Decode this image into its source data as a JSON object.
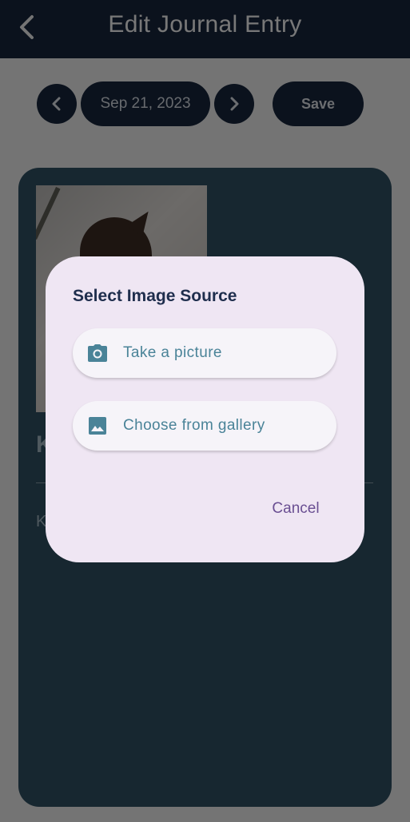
{
  "app_bar": {
    "title": "Edit Journal Entry",
    "back_icon": "chevron-left-icon"
  },
  "date_controls": {
    "prev_icon": "chevron-left-icon",
    "date": "Sep 21, 2023",
    "next_icon": "chevron-right-icon",
    "save_label": "Save"
  },
  "entry": {
    "title_preview": "K",
    "body_preview": "K"
  },
  "dialog": {
    "title": "Select Image Source",
    "options": [
      {
        "label": "Take a picture",
        "icon": "camera-icon"
      },
      {
        "label": "Choose from gallery",
        "icon": "image-icon"
      }
    ],
    "cancel_label": "Cancel"
  },
  "colors": {
    "app_bar": "#16243b",
    "card": "#2e4e60",
    "dialog": "#efe6f3",
    "option_text": "#4a8398",
    "cancel_text": "#6a4f92"
  }
}
